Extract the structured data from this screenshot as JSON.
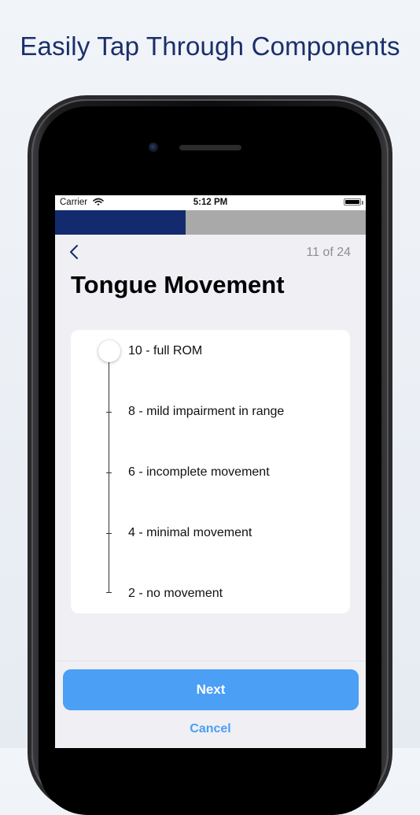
{
  "promo": {
    "title": "Easily Tap Through Components"
  },
  "status_bar": {
    "carrier": "Carrier",
    "time": "5:12 PM",
    "icons": [
      "wifi-icon",
      "battery-icon"
    ]
  },
  "progress": {
    "fraction": 0.42
  },
  "nav": {
    "back_icon": "chevron-left-icon",
    "counter": "11 of 24"
  },
  "title": "Tongue Movement",
  "scale": {
    "selected_index": 0,
    "options": [
      {
        "label": "10 - full ROM"
      },
      {
        "label": "8 - mild impairment in range"
      },
      {
        "label": "6 - incomplete movement"
      },
      {
        "label": "4 - minimal movement"
      },
      {
        "label": "2 - no movement"
      }
    ]
  },
  "actions": {
    "next_label": "Next",
    "cancel_label": "Cancel"
  },
  "colors": {
    "brand_navy": "#132b6e",
    "accent_blue": "#4b9ff5",
    "progress_track": "#a9a9a9"
  }
}
